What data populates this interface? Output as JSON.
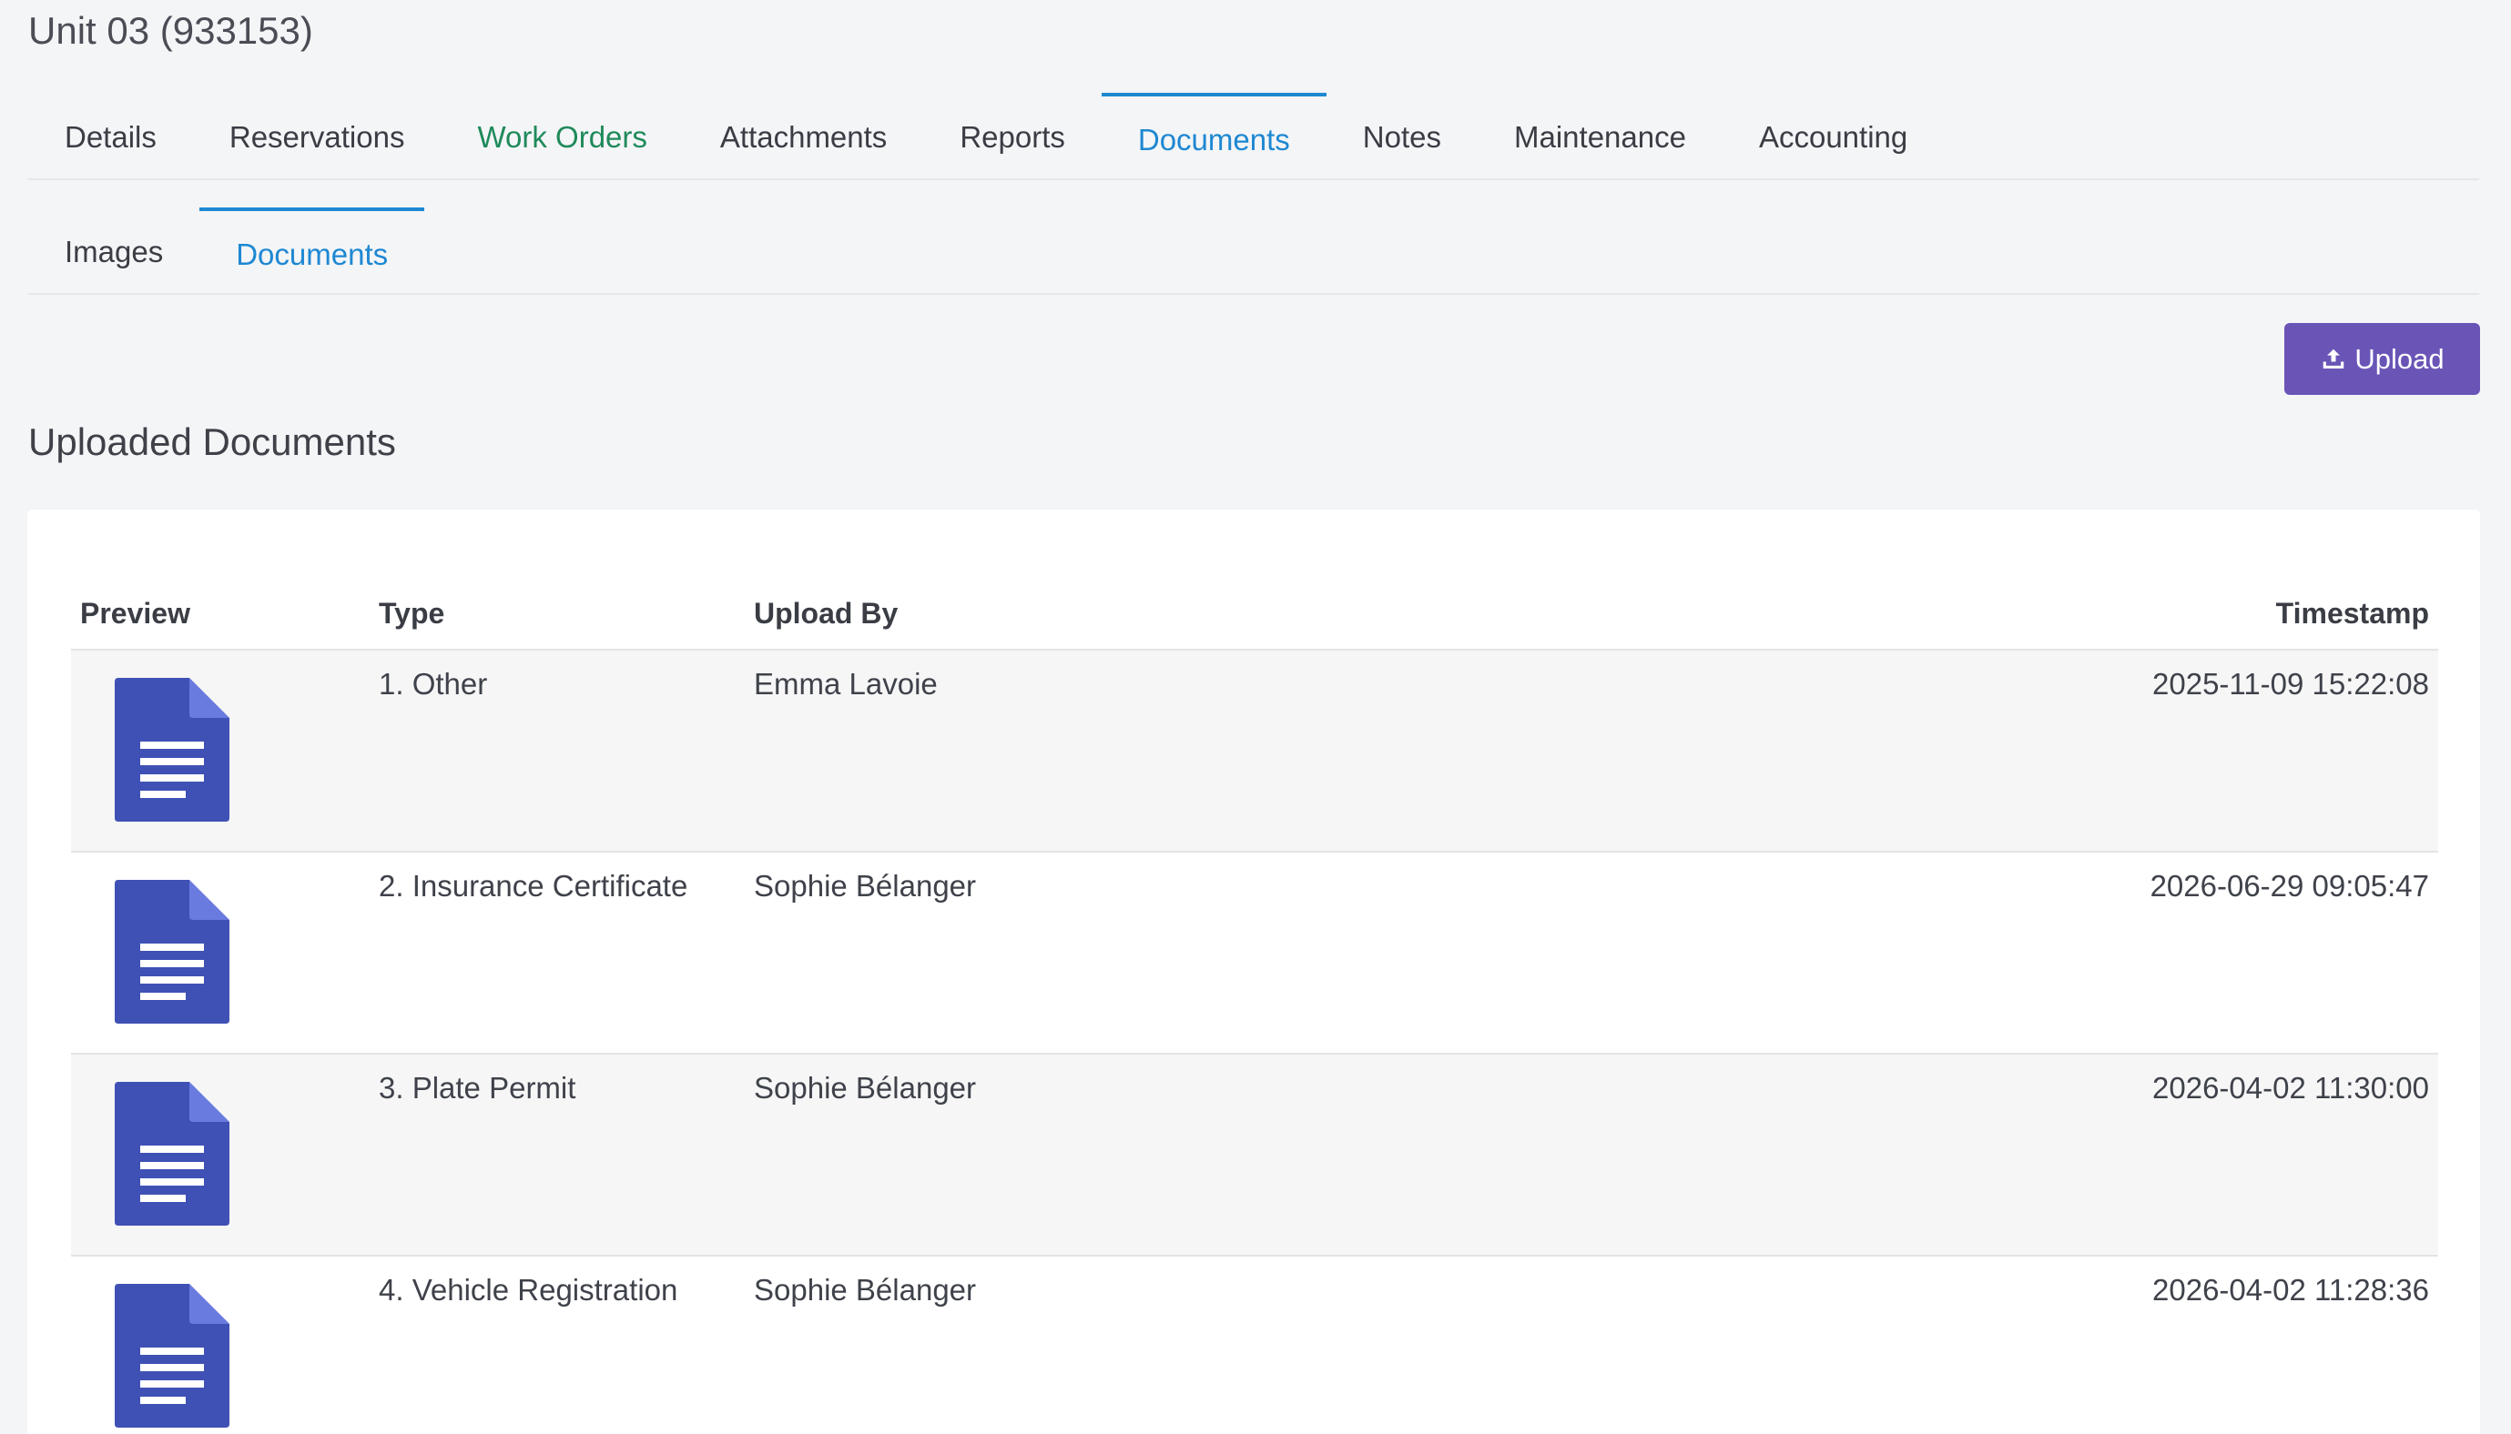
{
  "header": {
    "title": "Unit 03 (933153)"
  },
  "primary_tabs": [
    {
      "label": "Details"
    },
    {
      "label": "Reservations"
    },
    {
      "label": "Work Orders"
    },
    {
      "label": "Attachments"
    },
    {
      "label": "Reports"
    },
    {
      "label": "Documents"
    },
    {
      "label": "Notes"
    },
    {
      "label": "Maintenance"
    },
    {
      "label": "Accounting"
    }
  ],
  "secondary_tabs": [
    {
      "label": "Images"
    },
    {
      "label": "Documents"
    }
  ],
  "actions": {
    "upload_label": "Upload",
    "upload_icon": "upload-icon"
  },
  "section": {
    "title": "Uploaded Documents"
  },
  "table": {
    "columns": {
      "preview": "Preview",
      "type": "Type",
      "upload_by": "Upload By",
      "timestamp": "Timestamp"
    },
    "rows": [
      {
        "type": "1. Other",
        "upload_by": "Emma Lavoie",
        "timestamp": "2025-11-09 15:22:08",
        "icon": "document-icon"
      },
      {
        "type": "2. Insurance Certificate",
        "upload_by": "Sophie Bélanger",
        "timestamp": "2026-06-29 09:05:47",
        "icon": "document-icon"
      },
      {
        "type": "3. Plate Permit",
        "upload_by": "Sophie Bélanger",
        "timestamp": "2026-04-02 11:30:00",
        "icon": "document-icon"
      },
      {
        "type": "4. Vehicle Registration",
        "upload_by": "Sophie Bélanger",
        "timestamp": "2026-04-02 11:28:36",
        "icon": "document-icon"
      }
    ]
  },
  "colors": {
    "active_tab": "#1e88d2",
    "work_orders_tab": "#1f8a5b",
    "upload_button": "#6a55b7",
    "document_icon": "#3f51b5"
  }
}
